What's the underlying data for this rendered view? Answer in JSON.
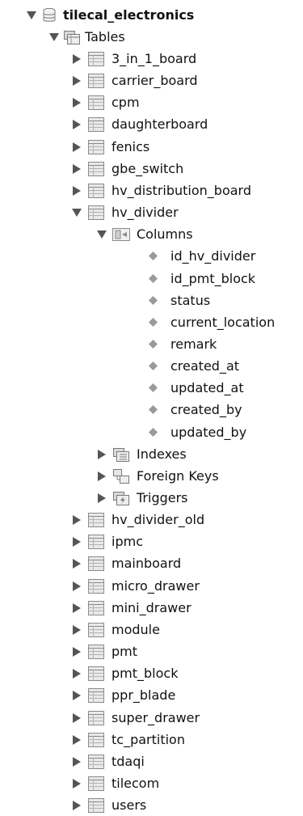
{
  "schema": {
    "name": "tilecal_electronics",
    "tables_label": "Tables",
    "tables_before": [
      "3_in_1_board",
      "carrier_board",
      "cpm",
      "daughterboard",
      "fenics",
      "gbe_switch",
      "hv_distribution_board"
    ],
    "expanded_table": {
      "name": "hv_divider",
      "columns_label": "Columns",
      "columns": [
        "id_hv_divider",
        "id_pmt_block",
        "status",
        "current_location",
        "remark",
        "created_at",
        "updated_at",
        "created_by",
        "updated_by"
      ],
      "indexes_label": "Indexes",
      "foreign_keys_label": "Foreign Keys",
      "triggers_label": "Triggers"
    },
    "tables_after": [
      "hv_divider_old",
      "ipmc",
      "mainboard",
      "micro_drawer",
      "mini_drawer",
      "module",
      "pmt",
      "pmt_block",
      "ppr_blade",
      "super_drawer",
      "tc_partition",
      "tdaqi",
      "tilecom",
      "users"
    ]
  },
  "colors": {
    "arrow": "#555555",
    "table_icon_border": "#8a8a8a",
    "table_icon_fill": "#e6e6e6",
    "diamond": "#9a9a9a",
    "text": "#111111"
  }
}
